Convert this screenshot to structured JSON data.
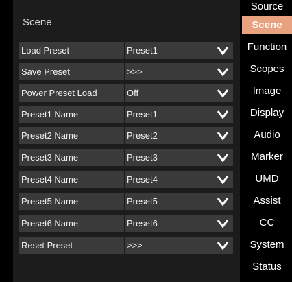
{
  "panel": {
    "title": "Scene"
  },
  "rows": [
    {
      "label": "Load Preset",
      "value": "Preset1"
    },
    {
      "label": "Save Preset",
      "value": ">>>"
    },
    {
      "label": "Power Preset Load",
      "value": "Off"
    },
    {
      "label": "Preset1 Name",
      "value": "Preset1"
    },
    {
      "label": "Preset2 Name",
      "value": "Preset2"
    },
    {
      "label": "Preset3 Name",
      "value": "Preset3"
    },
    {
      "label": "Preset4 Name",
      "value": "Preset4"
    },
    {
      "label": "Preset5 Name",
      "value": "Preset5"
    },
    {
      "label": "Preset6 Name",
      "value": "Preset6"
    },
    {
      "label": "Reset Preset",
      "value": ">>>"
    }
  ],
  "sidebar": {
    "active": "Scene",
    "items": [
      {
        "label": "Source"
      },
      {
        "label": "Scene"
      },
      {
        "label": "Function"
      },
      {
        "label": "Scopes"
      },
      {
        "label": "Image"
      },
      {
        "label": "Display"
      },
      {
        "label": "Audio"
      },
      {
        "label": "Marker"
      },
      {
        "label": "UMD"
      },
      {
        "label": "Assist"
      },
      {
        "label": "CC"
      },
      {
        "label": "System"
      },
      {
        "label": "Status"
      }
    ]
  },
  "colors": {
    "background": "#000000",
    "panel": "#1c1c1c",
    "row": "#3a3a3a",
    "active_tab": "#e9a27f",
    "text": "#ffffff"
  }
}
